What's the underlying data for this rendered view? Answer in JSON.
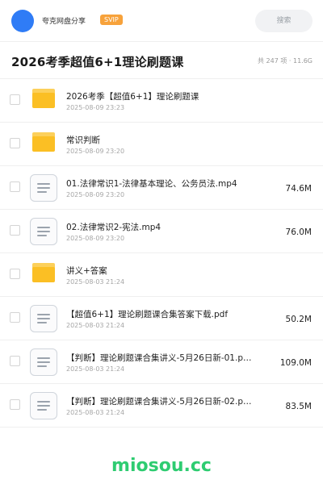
{
  "header": {
    "brand": "夸克网盘分享",
    "badge": "SVIP",
    "search_label": "搜索"
  },
  "page": {
    "title": "2026考季超值6+1理论刷题课",
    "summary": "共 247 项 · 11.6G"
  },
  "files": [
    {
      "type": "folder",
      "name": "2026考季【超值6+1】理论刷题课",
      "date": "2025-08-09 23:23",
      "size": ""
    },
    {
      "type": "folder",
      "name": "常识判断",
      "date": "2025-08-09 23:20",
      "size": ""
    },
    {
      "type": "file",
      "name": "01.法律常识1-法律基本理论、公务员法.mp4",
      "date": "2025-08-09 23:20",
      "size": "74.6M"
    },
    {
      "type": "file",
      "name": "02.法律常识2-宪法.mp4",
      "date": "2025-08-09 23:20",
      "size": "76.0M"
    },
    {
      "type": "folder",
      "name": "讲义+答案",
      "date": "2025-08-03 21:24",
      "size": ""
    },
    {
      "type": "file",
      "name": "【超值6+1】理论刷题课合集答案下载.pdf",
      "date": "2025-08-03 21:24",
      "size": "50.2M"
    },
    {
      "type": "file",
      "name": "【判断】理论刷题课合集讲义-5月26日新-01.p…",
      "date": "2025-08-03 21:24",
      "size": "109.0M"
    },
    {
      "type": "file",
      "name": "【判断】理论刷题课合集讲义-5月26日新-02.p…",
      "date": "2025-08-03 21:24",
      "size": "83.5M"
    }
  ],
  "watermark": "miosou.cc",
  "colors": {
    "accent_blue": "#2f7cf6",
    "svip_orange": "#f7a23b",
    "folder_yellow": "#fbbf24",
    "watermark_green": "#2ecc71"
  }
}
